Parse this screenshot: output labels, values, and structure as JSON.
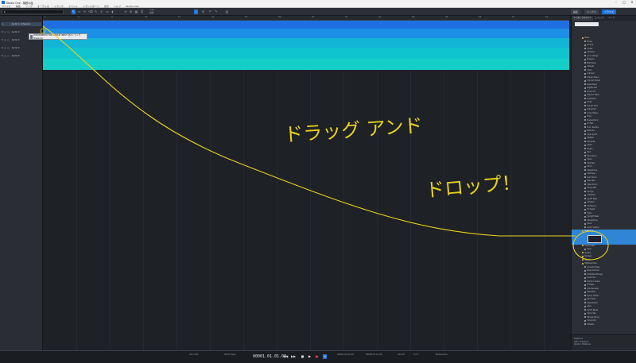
{
  "window": {
    "title": "Studio One - 無題の曲"
  },
  "menu": [
    "ファイル",
    "編集",
    "ソング",
    "オーディオ",
    "トラック",
    "イベント",
    "トランスポート",
    "表示",
    "ヘルプ",
    "Studio One"
  ],
  "toolbar": {
    "song_field": "▾",
    "quantize_label": "1/16",
    "snap_label": "調節",
    "browse_label": "ブラウズ",
    "mix_label": "ミックス",
    "edit_label": "編集",
    "start_label": "スタート",
    "song_label": "ソング",
    "project_label": "プロジェクト"
  },
  "tracks": [
    {
      "num": "1",
      "name": "Audio 1 / Channel"
    },
    {
      "num": "2",
      "name": "Audio 2"
    },
    {
      "num": "3",
      "name": "Audio 3"
    },
    {
      "num": "4",
      "name": "Audio 4"
    },
    {
      "num": "5",
      "name": "Audio 5"
    }
  ],
  "ruler_marks": [
    "1",
    "5",
    "9",
    "13",
    "17",
    "21",
    "25",
    "29",
    "33",
    "37",
    "41",
    "45",
    "49",
    "53",
    "57",
    "61"
  ],
  "drag_tooltip": {
    "line1": "PORTAMENTO FOR GROUP INPUT 次のトラック",
    "line2": "Presence"
  },
  "browser": {
    "tabs": [
      "インストゥルメント",
      "エフェクト",
      "ループ",
      "ファイル",
      "クラウド",
      "Presence"
    ],
    "items": [
      {
        "label": "Bass",
        "folder": true
      },
      {
        "label": "Brass"
      },
      {
        "label": "Drums"
      },
      {
        "label": "Guitar"
      },
      {
        "label": "ambient"
      },
      {
        "label": "Arco Strings"
      },
      {
        "label": "Bassoon"
      },
      {
        "label": "Bell Piano"
      },
      {
        "label": "Celesta"
      },
      {
        "label": "Choir"
      },
      {
        "label": "Clarinet"
      },
      {
        "label": "Classic Piano"
      },
      {
        "label": "Concert Grand"
      },
      {
        "label": "Deep Bass"
      },
      {
        "label": "Digital Pad"
      },
      {
        "label": "Drum Kit"
      },
      {
        "label": "Electric Piano"
      },
      {
        "label": "Ensemble"
      },
      {
        "label": "Flute"
      },
      {
        "label": "French Horn"
      },
      {
        "label": "Glass Pad"
      },
      {
        "label": "Grand Piano"
      },
      {
        "label": "Harp"
      },
      {
        "label": "Harpsichord"
      },
      {
        "label": "Hi-Hat"
      },
      {
        "label": "Horn Section"
      },
      {
        "label": "Kalimba"
      },
      {
        "label": "Lead Synth"
      },
      {
        "label": "Mallets"
      },
      {
        "label": "Marimba"
      },
      {
        "label": "Oboe"
      },
      {
        "label": "Organ"
      },
      {
        "label": "Pad"
      },
      {
        "label": "Percussion"
      },
      {
        "label": "Piano"
      },
      {
        "label": "Pizzicato"
      },
      {
        "label": "Pluck"
      },
      {
        "label": "Saxophone"
      },
      {
        "label": "Soft Keys"
      },
      {
        "label": "Solo Violin"
      },
      {
        "label": "Staccato"
      },
      {
        "label": "Steel Drum"
      },
      {
        "label": "String Pad"
      },
      {
        "label": "Strings"
      },
      {
        "label": "Sub Bass"
      },
      {
        "label": "Synth Bass"
      },
      {
        "label": "Timpani"
      },
      {
        "label": "Trombone"
      },
      {
        "label": "Trumpet"
      },
      {
        "label": "Tuba"
      },
      {
        "label": "Upright Bass"
      },
      {
        "label": "Vibraphone"
      },
      {
        "label": "Viola"
      },
      {
        "label": "Violin Section"
      },
      {
        "label": "Presence",
        "folder": true
      }
    ],
    "items_after": [
      {
        "label": "Sound Sets",
        "folder": true
      },
      {
        "label": "Keys"
      },
      {
        "label": "Synths",
        "folder": true
      },
      {
        "label": "Vintage",
        "folder": true
      },
      {
        "label": "World",
        "folder": true
      },
      {
        "label": "Multisamples",
        "folder": true
      },
      {
        "label": "Acoustic Bass"
      },
      {
        "label": "Bass Clarinet"
      },
      {
        "label": "Chamber Strings"
      },
      {
        "label": "Dulcimer"
      },
      {
        "label": "Electric Guitar"
      },
      {
        "label": "Fretless"
      },
      {
        "label": "Glockenspiel"
      },
      {
        "label": "Mandolin"
      },
      {
        "label": "Nylon Guitar"
      },
      {
        "label": "Pan Flute"
      },
      {
        "label": "Shakuhachi"
      },
      {
        "label": "Sitar"
      },
      {
        "label": "Synth Brass"
      },
      {
        "label": "Tenor Sax"
      },
      {
        "label": "Twelve String"
      },
      {
        "label": "Vocal Ahh"
      },
      {
        "label": "Whistle"
      }
    ],
    "info_line1": "Presence",
    "info_line2": "Instr.: Presence",
    "info_line3": "Vendor: PreSonus"
  },
  "transport": {
    "time": "00001.01.01.00",
    "sample_rate": "44.1 kHz",
    "record_time": "46:03 days",
    "latency": "2.4 / 4.8 ms",
    "left_loc": "00001.01.01.00",
    "right_loc": "00005.01.01.00",
    "tempo": "120.00",
    "signature": "4 / 4",
    "metronome_label": "Metronome"
  },
  "annotation": {
    "text1": "ドラッグ アンド",
    "text2": "ドロップ！",
    "color": "#e8d21a"
  }
}
